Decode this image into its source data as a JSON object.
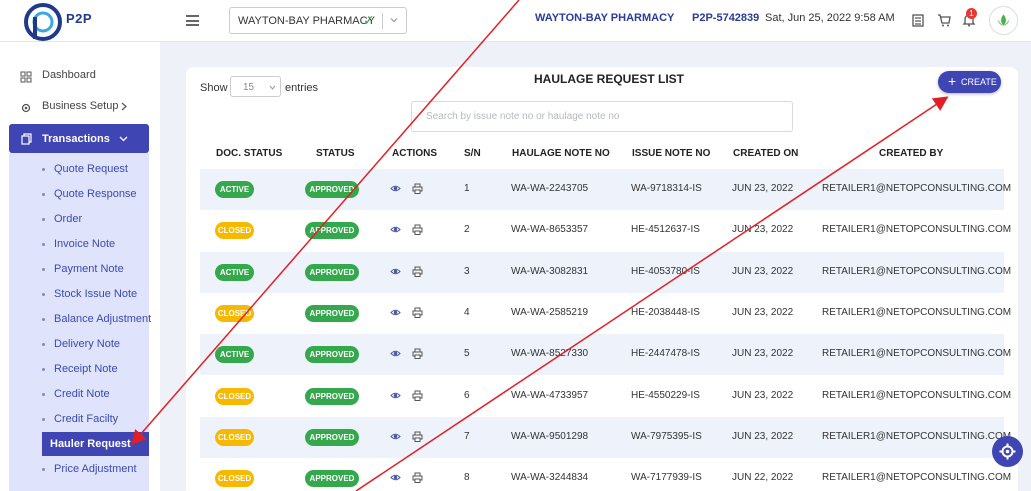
{
  "brand": {
    "logo_text": "P2P"
  },
  "topbar": {
    "pharmacy_select_value": "WAYTON-BAY PHARMACY",
    "pharmacy_name": "WAYTON-BAY PHARMACY",
    "account_code": "P2P-5742839",
    "datetime": "Sat, Jun 25, 2022 9:58 AM",
    "notification_count": "1"
  },
  "sidebar": {
    "dashboard": "Dashboard",
    "business_setup": "Business Setup",
    "transactions": "Transactions",
    "sub_items": [
      "Quote Request",
      "Quote Response",
      "Order",
      "Invoice Note",
      "Payment Note",
      "Stock Issue Note",
      "Balance Adjustment",
      "Delivery Note",
      "Receipt Note",
      "Credit Note",
      "Credit Facilty",
      "Hauler Request",
      "Price Adjustment"
    ],
    "active_item": "Hauler Request"
  },
  "page": {
    "title": "HAULAGE REQUEST LIST",
    "show_label": "Show",
    "entries_value": "15",
    "entries_label": "entries",
    "create_label": "CREATE",
    "search_placeholder": "Search by issue note no or haulage note no"
  },
  "table": {
    "headers": [
      "DOC. STATUS",
      "STATUS",
      "ACTIONS",
      "S/N",
      "HAULAGE NOTE NO",
      "ISSUE NOTE NO",
      "CREATED ON",
      "CREATED BY"
    ],
    "rows": [
      {
        "doc_status": "ACTIVE",
        "status": "APPROVED",
        "sn": "1",
        "haulage": "WA-WA-2243705",
        "issue": "WA-9718314-IS",
        "created_on": "JUN 23, 2022",
        "created_by": "RETAILER1@NETOPCONSULTING.COM"
      },
      {
        "doc_status": "CLOSED",
        "status": "APPROVED",
        "sn": "2",
        "haulage": "WA-WA-8653357",
        "issue": "HE-4512637-IS",
        "created_on": "JUN 23, 2022",
        "created_by": "RETAILER1@NETOPCONSULTING.COM"
      },
      {
        "doc_status": "ACTIVE",
        "status": "APPROVED",
        "sn": "3",
        "haulage": "WA-WA-3082831",
        "issue": "HE-4053780-IS",
        "created_on": "JUN 23, 2022",
        "created_by": "RETAILER1@NETOPCONSULTING.COM"
      },
      {
        "doc_status": "CLOSED",
        "status": "APPROVED",
        "sn": "4",
        "haulage": "WA-WA-2585219",
        "issue": "HE-2038448-IS",
        "created_on": "JUN 23, 2022",
        "created_by": "RETAILER1@NETOPCONSULTING.COM"
      },
      {
        "doc_status": "ACTIVE",
        "status": "APPROVED",
        "sn": "5",
        "haulage": "WA-WA-8527330",
        "issue": "HE-2447478-IS",
        "created_on": "JUN 23, 2022",
        "created_by": "RETAILER1@NETOPCONSULTING.COM"
      },
      {
        "doc_status": "CLOSED",
        "status": "APPROVED",
        "sn": "6",
        "haulage": "WA-WA-4733957",
        "issue": "HE-4550229-IS",
        "created_on": "JUN 23, 2022",
        "created_by": "RETAILER1@NETOPCONSULTING.COM"
      },
      {
        "doc_status": "CLOSED",
        "status": "APPROVED",
        "sn": "7",
        "haulage": "WA-WA-9501298",
        "issue": "WA-7975395-IS",
        "created_on": "JUN 23, 2022",
        "created_by": "RETAILER1@NETOPCONSULTING.COM"
      },
      {
        "doc_status": "CLOSED",
        "status": "APPROVED",
        "sn": "8",
        "haulage": "WA-WA-3244834",
        "issue": "WA-7177939-IS",
        "created_on": "JUN 22, 2022",
        "created_by": "RETAILER1@NETOPCONSULTING.COM"
      }
    ]
  },
  "icons": {
    "menu": "hamburger-icon",
    "check": "check-icon",
    "chevron": "chevron-down-icon",
    "dashboard": "grid-icon",
    "business": "gear-icon",
    "transactions": "copy-icon",
    "view": "eye-icon",
    "print": "printer-icon",
    "report": "document-icon",
    "cart": "cart-icon",
    "bell": "bell-icon",
    "settings_fab": "gear-icon"
  },
  "colors": {
    "primary": "#3f45b3",
    "active_badge": "#35a84e",
    "closed_badge": "#f6b800",
    "annotation_arrow": "#e31e24"
  }
}
